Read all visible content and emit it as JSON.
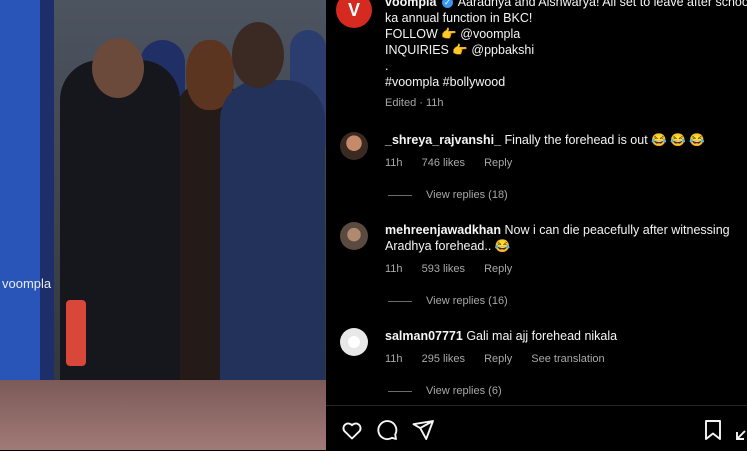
{
  "video": {
    "watermark": "voompla"
  },
  "post": {
    "username": "voompla",
    "caption_lines": [
      "Aaradhya and Aishwarya! All set to leave after school",
      "ka annual function in BKC!",
      "FOLLOW 👉 @voompla",
      "INQUIRIES 👉 @ppbakshi",
      ".",
      "#voompla #bollywood"
    ],
    "edited": "Edited · 11h"
  },
  "comments": [
    {
      "user": "_shreya_rajvanshi_",
      "text": "Finally the forehead is out 😂 😂 😂",
      "time": "11h",
      "likes": "746 likes",
      "reply": "Reply",
      "view_replies": "View replies (18)"
    },
    {
      "user": "mehreenjawadkhan",
      "text": "Now i can die peacefully after witnessing Aradhya forehead.. 😂",
      "time": "11h",
      "likes": "593 likes",
      "reply": "Reply",
      "view_replies": "View replies (16)"
    },
    {
      "user": "salman07771",
      "text": "Gali mai ajj forehead nikala",
      "time": "11h",
      "likes": "295 likes",
      "reply": "Reply",
      "translation": "See translation",
      "view_replies": "View replies (6)"
    }
  ],
  "icons": {
    "like": "heart-icon",
    "comment": "comment-icon",
    "share": "send-icon",
    "save": "bookmark-icon",
    "more": "expand-icon"
  },
  "colors": {
    "verified": "#3897f0",
    "brand": "#d42a1f"
  }
}
